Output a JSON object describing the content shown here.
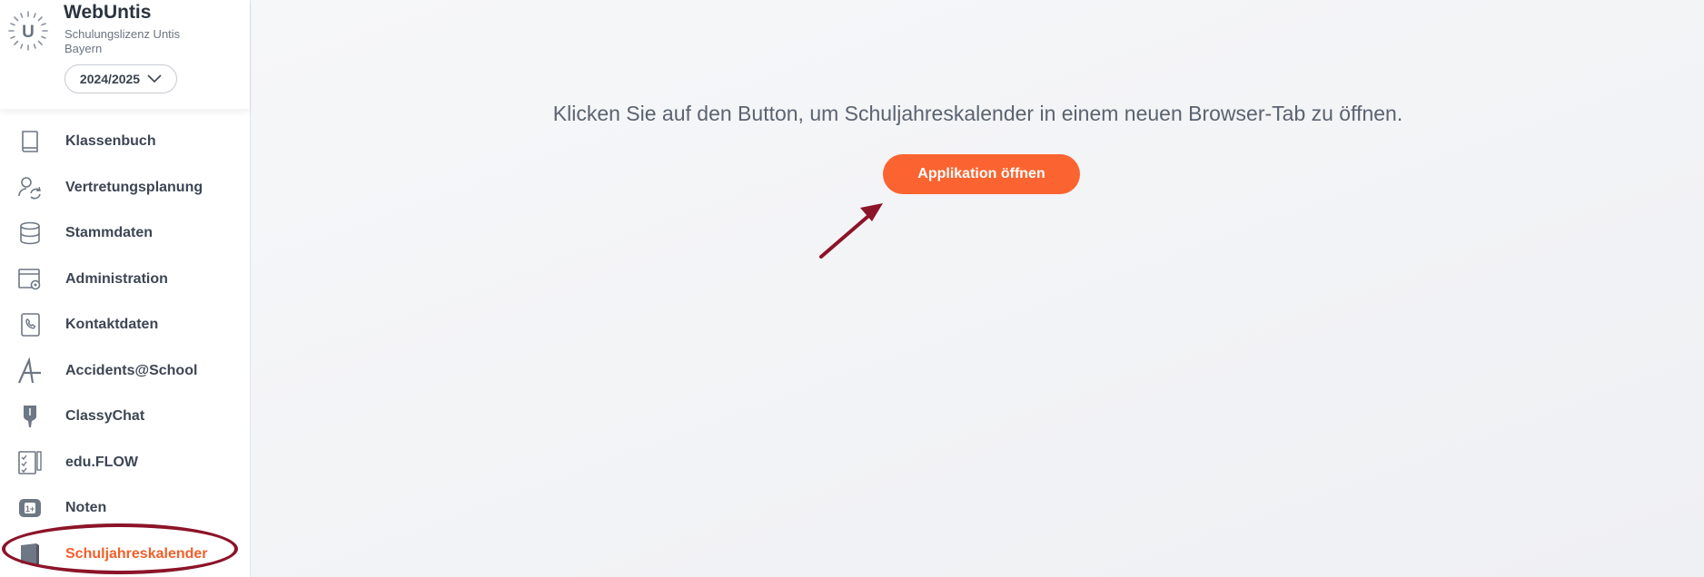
{
  "app": {
    "name": "WebUntis",
    "license": "Schulungslizenz Untis Bayern",
    "school_year": "2024/2025"
  },
  "sidebar": {
    "items": [
      {
        "label": "Klassenbuch",
        "icon": "book-icon"
      },
      {
        "label": "Vertretungsplanung",
        "icon": "person-sync-icon"
      },
      {
        "label": "Stammdaten",
        "icon": "database-icon"
      },
      {
        "label": "Administration",
        "icon": "window-gear-icon"
      },
      {
        "label": "Kontaktdaten",
        "icon": "phone-book-icon"
      },
      {
        "label": "Accidents@School",
        "icon": "accidents-logo-icon"
      },
      {
        "label": "ClassyChat",
        "icon": "classychat-icon"
      },
      {
        "label": "edu.FLOW",
        "icon": "checklist-icon"
      },
      {
        "label": "Noten",
        "icon": "grades-icon"
      },
      {
        "label": "Schuljahreskalender",
        "icon": "calendar-book-icon",
        "active": true
      }
    ]
  },
  "main": {
    "message": "Klicken Sie auf den Button, um Schuljahreskalender in einem neuen Browser-Tab zu öffnen.",
    "button_label": "Applikation öffnen"
  },
  "colors": {
    "accent": "#fb6430",
    "active_text": "#f0602b",
    "annotation": "#8c1428"
  }
}
